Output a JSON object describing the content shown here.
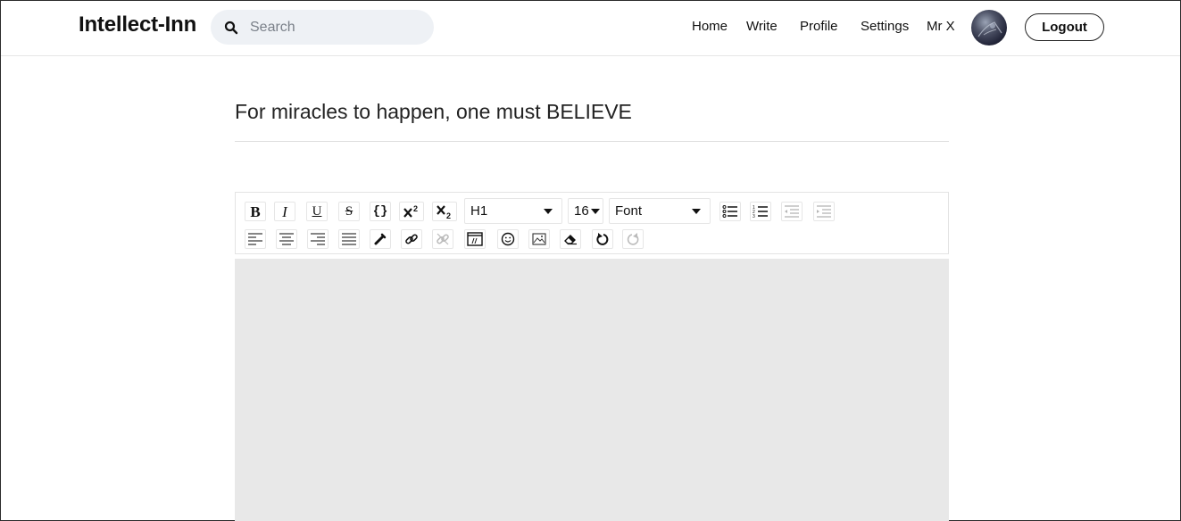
{
  "navbar": {
    "brand": "Intellect-Inn",
    "search_placeholder": "Search",
    "links": {
      "home": "Home",
      "write": "Write",
      "profile": "Profile",
      "settings": "Settings",
      "username": "Mr X"
    },
    "logout_label": "Logout"
  },
  "post": {
    "title": "For miracles to happen, one must BELIEVE"
  },
  "toolbar": {
    "bold": "B",
    "italic": "I",
    "underline": "U",
    "strike": "S",
    "code": "{}",
    "block_format": "H1",
    "font_size": "16",
    "font_family": "Font"
  },
  "colors": {
    "editor_bg": "#e8e8e8",
    "search_bg": "#eef1f5"
  }
}
